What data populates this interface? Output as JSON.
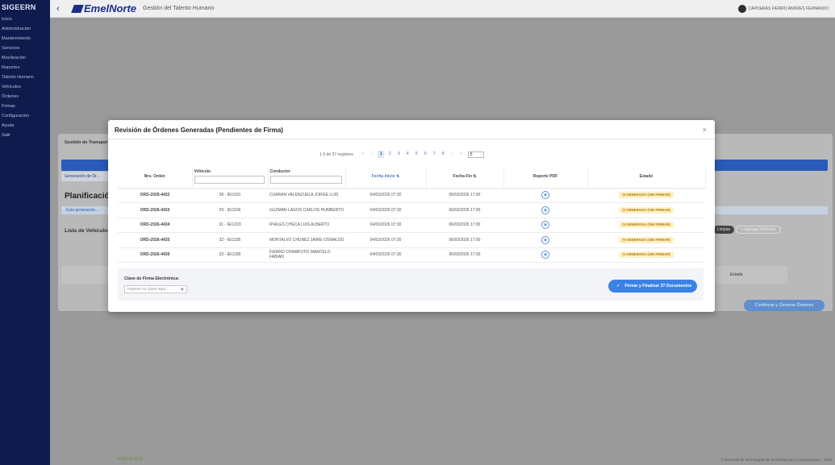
{
  "sidebar": {
    "brand": "SIGEERN",
    "items": [
      "Inicio",
      "Administración",
      "Mantenimiento",
      "Servicios",
      "Movilización",
      "Reportes",
      "Talento Humano",
      "Vehículos",
      "Órdenes",
      "Firmas",
      "Configuración",
      "Ayuda",
      "Salir"
    ]
  },
  "topbar": {
    "back": "‹",
    "logo_text": "EmelNorte",
    "subtitle": "Gestión del Talento Humano",
    "user": "CAPDERAS FIERRO ANDRES FERNANDO"
  },
  "background": {
    "breadcrumb": "Gestión de Transporte",
    "tab": "Generación de Ór...",
    "title": "Planificación",
    "info": "Esta generación...",
    "vehicles_label": "Lista de Vehículos",
    "pill_dark": "Limpiar",
    "pill_add": "+ Agregar Vehículo",
    "table_head": "Estado",
    "confirm_btn": "Confirmar y Generar Órdenes",
    "footer_left": "EMELNORTE",
    "footer_right": "© Dirección de Tecnologías de la Información y Comunicación · 2026"
  },
  "modal": {
    "title": "Revisión de Órdenes Generadas (Pendientes de Firma)",
    "close": "×",
    "pager": {
      "count": "1-5 de 37 registros",
      "first": "«",
      "prev": "‹",
      "pages": [
        "1",
        "2",
        "3",
        "4",
        "5",
        "6",
        "7",
        "8"
      ],
      "active_page": "1",
      "next": "›",
      "last": "»",
      "per_page": "5"
    },
    "columns": {
      "orden": "Nro. Orden",
      "vehiculo": "Vehículo",
      "conductor": "Conductor",
      "inicio": "Fecha Inicio ⇅",
      "fin": "Fecha Fin ⇅",
      "pdf": "Reporte PDF",
      "estado": "Estado"
    },
    "rows": [
      {
        "orden": "ORD-2026-4432",
        "vehiculo": "28 - IEI1181",
        "conductor": "CUARAN VALENZUELA JORGE LUIS",
        "inicio": "04/03/2026 07:30",
        "fin": "06/03/2026 17:00",
        "estado": "GENERADA (SIN FIRMAR)"
      },
      {
        "orden": "ORD-2026-4433",
        "vehiculo": "29 - IEI1166",
        "conductor": "GUZMAN LAGOS CARLOS HUMBERTO",
        "inicio": "04/03/2026 07:30",
        "fin": "06/03/2026 17:00",
        "estado": "GENERADA (SIN FIRMAR)"
      },
      {
        "orden": "ORD-2026-4434",
        "vehiculo": "31 - IEI1203",
        "conductor": "IPIALES CHECA LUIS ALBERTO",
        "inicio": "04/03/2026 07:30",
        "fin": "06/03/2026 17:00",
        "estado": "GENERADA (SIN FIRMAR)"
      },
      {
        "orden": "ORD-2026-4435",
        "vehiculo": "32 - IEI1185",
        "conductor": "MONTALVO CHUNEZ JAIME OSWALDO",
        "inicio": "04/03/2026 07:30",
        "fin": "06/03/2026 17:00",
        "estado": "GENERADA (SIN FIRMAR)"
      },
      {
        "orden": "ORD-2026-4436",
        "vehiculo": "33 - IEI1189",
        "conductor": "FIERRO CHAMPUTIZ MARCELO FABIAN",
        "inicio": "04/03/2026 07:30",
        "fin": "06/03/2026 17:00",
        "estado": "GENERADA (SIN FIRMAR)"
      }
    ],
    "sign": {
      "label": "Clave de Firma Electrónica:",
      "placeholder": "Ingrese su clave aquí...",
      "eye_icon": "eye-icon",
      "button": "Firmar y Finalizar 37 Documentos"
    }
  },
  "colors": {
    "sidebar": "#0f1b4c",
    "accent": "#3b82e6",
    "status_bg": "#fff1c6",
    "status_text": "#b07a00"
  }
}
